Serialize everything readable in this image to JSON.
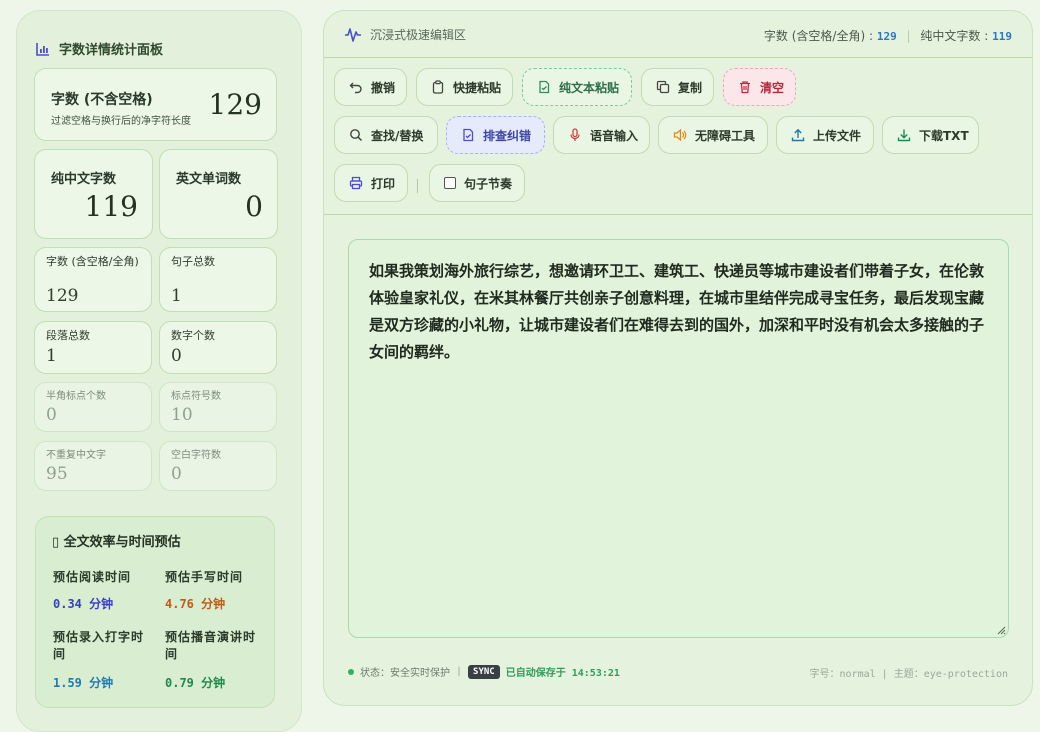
{
  "stats_panel": {
    "title": "字数详情统计面板",
    "main": {
      "label": "字数 (不含空格)",
      "sub": "过滤空格与换行后的净字符长度",
      "value": "129"
    },
    "chinese": {
      "label": "纯中文字数",
      "value": "119"
    },
    "english": {
      "label": "英文单词数",
      "value": "0"
    },
    "with_spaces": {
      "label": "字数 (含空格/全角)",
      "value": "129"
    },
    "sentences": {
      "label": "句子总数",
      "value": "1"
    },
    "paragraphs": {
      "label": "段落总数",
      "value": "1"
    },
    "digits": {
      "label": "数字个数",
      "value": "0"
    },
    "half_punct": {
      "label": "半角标点个数",
      "value": "0"
    },
    "punct": {
      "label": "标点符号数",
      "value": "10"
    },
    "unique_cn": {
      "label": "不重复中文字",
      "value": "95"
    },
    "whitespace": {
      "label": "空白字符数",
      "value": "0"
    }
  },
  "efficiency": {
    "title": "▯ 全文效率与时间预估",
    "reading": {
      "label": "预估阅读时间",
      "value": "0.34 分钟",
      "color": "#3a3fc0"
    },
    "handwriting": {
      "label": "预估手写时间",
      "value": "4.76 分钟",
      "color": "#c05a14"
    },
    "typing": {
      "label": "预估录入打字时间",
      "value": "1.59 分钟",
      "color": "#1e7ab0"
    },
    "broadcast": {
      "label": "预估播音演讲时间",
      "value": "0.79 分钟",
      "color": "#1e8a4a"
    }
  },
  "editor": {
    "title": "沉浸式极速编辑区",
    "count_label": "字数 (含空格/全角)",
    "count_value": "129",
    "cn_label": "纯中文字数",
    "cn_value": "119",
    "content": "如果我策划海外旅行综艺，想邀请环卫工、建筑工、快递员等城市建设者们带着子女，在伦敦体验皇家礼仪，在米其林餐厅共创亲子创意料理，在城市里结伴完成寻宝任务，最后发现宝藏是双方珍藏的小礼物，让城市建设者们在难得去到的国外，加深和平时没有机会太多接触的子女间的羁绊。"
  },
  "toolbar": {
    "undo": "撤销",
    "quick_paste": "快捷粘贴",
    "plain_paste": "纯文本粘贴",
    "copy": "复制",
    "clear": "清空",
    "find_replace": "查找/替换",
    "typeset": "排查纠错",
    "voice": "语音输入",
    "accessibility": "无障碍工具",
    "upload": "上传文件",
    "download": "下载TXT",
    "print": "打印",
    "rhythm": "句子节奏"
  },
  "footer": {
    "status": "状态：安全实时保护",
    "sync": "SYNC",
    "saved": "已自动保存于 14:53:21",
    "right": "字号：normal | 主题：eye-protection"
  },
  "colors": {
    "accent_green": "#2fae6a",
    "number_blue": "#2b78c0",
    "clear_red": "#b8283c"
  }
}
